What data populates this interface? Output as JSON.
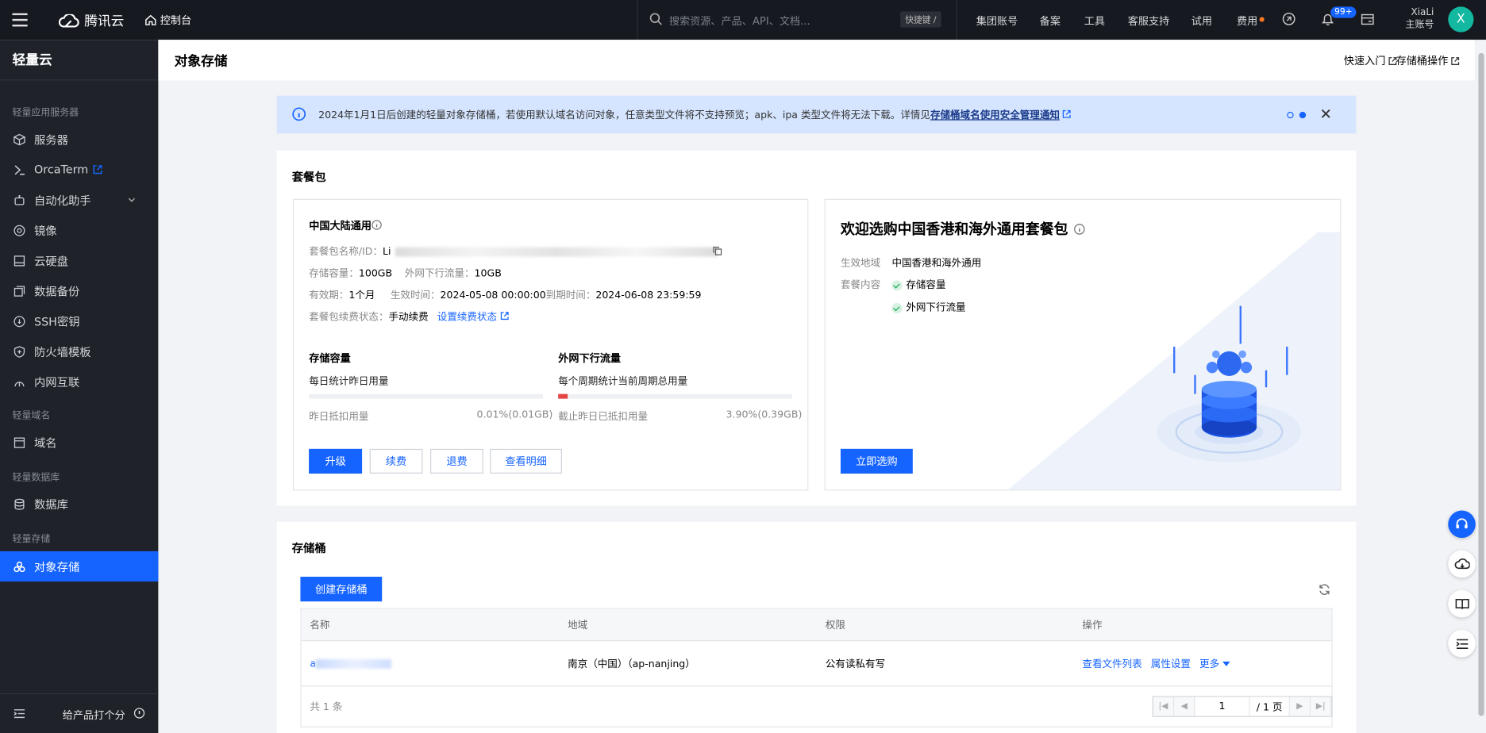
{
  "topbar": {
    "brand": "腾讯云",
    "console": "控制台",
    "search_placeholder": "搜索资源、产品、API、文档...",
    "shortcut": "快捷键 /",
    "nav": [
      "集团账号",
      "备案",
      "工具",
      "客服支持",
      "试用",
      "费用"
    ],
    "bell_badge": "99+",
    "user_name": "XiaLi",
    "user_role": "主账号",
    "avatar_letter": "X"
  },
  "sidebar": {
    "title": "轻量云",
    "groups": [
      "轻量应用服务器",
      "轻量域名",
      "轻量数据库",
      "轻量存储"
    ],
    "items": [
      {
        "label": "服务器",
        "icon": "cube-icon"
      },
      {
        "label": "OrcaTerm",
        "icon": "terminal-icon"
      },
      {
        "label": "自动化助手",
        "icon": "automation-icon"
      },
      {
        "label": "镜像",
        "icon": "image-disc-icon"
      },
      {
        "label": "云硬盘",
        "icon": "disk-icon"
      },
      {
        "label": "数据备份",
        "icon": "backup-icon"
      },
      {
        "label": "SSH密钥",
        "icon": "key-icon"
      },
      {
        "label": "防火墙模板",
        "icon": "shield-icon"
      },
      {
        "label": "内网互联",
        "icon": "network-icon"
      },
      {
        "label": "域名",
        "icon": "domain-icon"
      },
      {
        "label": "数据库",
        "icon": "database-icon"
      },
      {
        "label": "对象存储",
        "icon": "object-storage-icon"
      }
    ],
    "feedback": "给产品打个分"
  },
  "page": {
    "title": "对象存储",
    "links": [
      "快速入门",
      "存储桶操作"
    ]
  },
  "notice": {
    "text": "2024年1月1日后创建的轻量对象存储桶，若使用默认域名访问对象，任意类型文件将不支持预览；apk、ipa 类型文件将无法下载。详情见",
    "link": "存储桶域名使用安全管理通知"
  },
  "package": {
    "section_title": "套餐包",
    "region_title": "中国大陆通用",
    "name_label": "套餐包名称/ID：",
    "name_value": "Li",
    "capacity_label": "存储容量：",
    "capacity_value": "100GB",
    "traffic_label": "外网下行流量：",
    "traffic_value": "10GB",
    "validity_label": "有效期：",
    "validity_value": "1个月",
    "start_label": "生效时间：",
    "start_value": "2024-05-08 00:00:00",
    "end_label": "到期时间：",
    "end_value": "2024-06-08 23:59:59",
    "renew_label": "套餐包续费状态：",
    "renew_value": "手动续费",
    "renew_link": "设置续费状态",
    "storage": {
      "title": "存储容量",
      "desc": "每日统计昨日用量",
      "used_label": "昨日抵扣用量",
      "used_value": "0.01%(0.01GB)",
      "percent": 0.01
    },
    "traffic": {
      "title": "外网下行流量",
      "desc": "每个周期统计当前周期总用量",
      "used_label": "截止昨日已抵扣用量",
      "used_value": "3.90%(0.39GB)",
      "percent": 3.9
    },
    "buttons": [
      "升级",
      "续费",
      "退费",
      "查看明细"
    ]
  },
  "promo": {
    "title": "欢迎选购中国香港和海外通用套餐包",
    "region_label": "生效地域",
    "region_value": "中国香港和海外通用",
    "content_label": "套餐内容",
    "content_items": [
      "存储容量",
      "外网下行流量"
    ],
    "button": "立即选购"
  },
  "buckets": {
    "section_title": "存储桶",
    "create_button": "创建存储桶",
    "columns": [
      "名称",
      "地域",
      "权限",
      "操作"
    ],
    "rows": [
      {
        "name": "a",
        "region": "南京（中国）（ap-nanjing）",
        "permission": "公有读私有写",
        "actions": [
          "查看文件列表",
          "属性设置",
          "更多"
        ]
      }
    ],
    "total": "共 1 条",
    "page_value": "1",
    "page_total": "/ 1 页"
  },
  "colors": {
    "primary": "#1664ff",
    "topbar": "#161a20",
    "sidebar": "#1f2329",
    "notice_bg": "#d5e5ff",
    "danger": "#e54545"
  }
}
